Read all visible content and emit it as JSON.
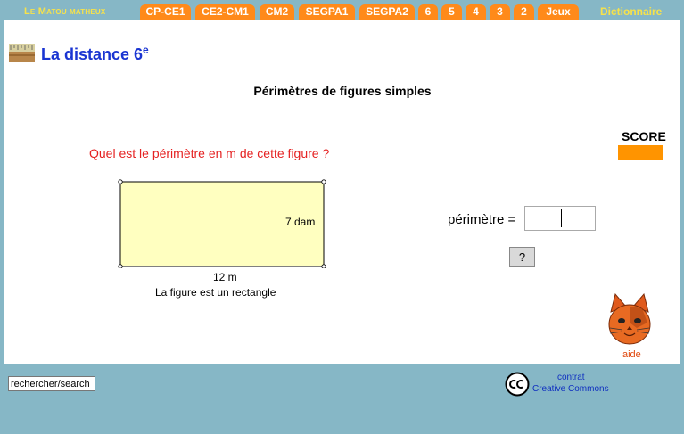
{
  "header": {
    "brand": "Le Matou matheux",
    "tabs": [
      "CP-CE1",
      "CE2-CM1",
      "CM2",
      "SEGPA1",
      "SEGPA2",
      "6",
      "5",
      "4",
      "3",
      "2",
      "Jeux"
    ],
    "dictionary": "Dictionnaire"
  },
  "lesson": {
    "title": "La distance 6",
    "title_sup": "e",
    "subtitle": "Périmètres de figures simples"
  },
  "score": {
    "label": "SCORE"
  },
  "exercise": {
    "question": "Quel est le périmètre en m de cette figure ?",
    "width_label": "12 m",
    "height_label": "7 dam",
    "figure_caption": "La figure est un rectangle",
    "answer_label": "périmètre =",
    "answer_value": "",
    "help_button": "?"
  },
  "help": {
    "label": "aide",
    "icon": "cat-icon"
  },
  "footer": {
    "search_value": "rechercher/search",
    "license_line1": "contrat",
    "license_line2": "Creative Commons",
    "license_icon": "cc-icon"
  },
  "colors": {
    "background": "#86b7c6",
    "tab": "#ff8a1a",
    "brand": "#f7e24a",
    "title": "#1a35d2",
    "question": "#e52222",
    "rectangle_fill": "#ffffc0",
    "score_bar": "#ff9400"
  }
}
